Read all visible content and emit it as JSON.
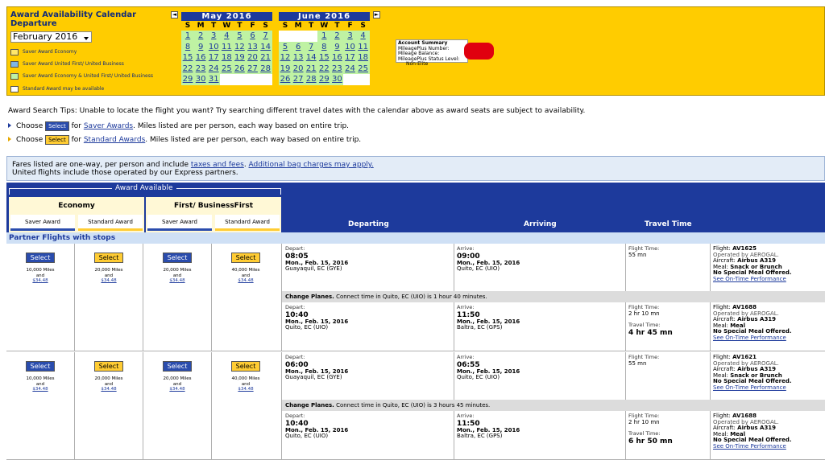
{
  "top": {
    "title_line1": "Award Availability Calendar",
    "title_line2": "Departure",
    "month_select": "February 2016",
    "legend": [
      {
        "label": "Saver Award Economy",
        "color": "#ffe76a"
      },
      {
        "label": "Saver Award United First/ United Business",
        "color": "#7fb6e6"
      },
      {
        "label": "Saver Award Economy & United First/ United Business",
        "color": "#bff2a3"
      },
      {
        "label": "Standard Award may be available",
        "color": "#ffffff"
      }
    ],
    "cal1": {
      "title": "May 2016",
      "days": [
        "S",
        "M",
        "T",
        "W",
        "T",
        "F",
        "S"
      ]
    },
    "cal2": {
      "title": "June 2016",
      "days": [
        "S",
        "M",
        "T",
        "W",
        "T",
        "F",
        "S"
      ]
    },
    "prev_icon": "◄",
    "next_icon": "►",
    "account": {
      "heading": "Account Summary",
      "l1": "MileagePlus Number:",
      "l2": "Mileage Balance:",
      "l3": "MileagePlus Status Level:",
      "status": "Non-Elite"
    }
  },
  "tips": {
    "line1": "Award Search Tips: Unable to locate the flight you want? Try searching different travel dates with the calendar above as award seats are subject to availability.",
    "choose": "Choose",
    "select": "Select",
    "for": "for",
    "saver_link": "Saver Awards",
    "standard_link": "Standard Awards",
    "rest": ". Miles listed are per person, each way based on entire trip."
  },
  "fares": {
    "a": "Fares listed are one-way, per person and include ",
    "taxes": "taxes and fees",
    "b": ". ",
    "bag": "Additional bag charges may apply.",
    "line2": "United flights include those operated by our Express partners."
  },
  "header": {
    "award_available": "Award Available",
    "economy": "Economy",
    "first": "First/ BusinessFirst",
    "saver": "Saver Award",
    "standard": "Standard Award",
    "departing": "Departing",
    "arriving": "Arriving",
    "travel_time": "Travel Time"
  },
  "partner": "Partner Flights with stops",
  "labels": {
    "depart": "Depart:",
    "arrive": "Arrive:",
    "flight_time": "Flight Time:",
    "travel_time": "Travel Time:",
    "flight": "Flight:",
    "aircraft": "Aircraft:",
    "meal": "Meal:",
    "no_special": "No Special Meal Offered.",
    "ontime": "See On-Time Performance",
    "change": "Change Planes.",
    "and": "and",
    "select": "Select"
  },
  "itineraries": [
    {
      "awards": [
        {
          "miles": "10,000 Miles",
          "tax": "$34.48"
        },
        {
          "miles": "20,000 Miles",
          "tax": "$34.48"
        },
        {
          "miles": "20,000 Miles",
          "tax": "$34.48"
        },
        {
          "miles": "40,000 Miles",
          "tax": "$34.48"
        }
      ],
      "seg1": {
        "dep_time": "08:05",
        "dep_date": "Mon., Feb. 15, 2016",
        "dep_city": "Guayaquil, EC (GYE)",
        "arr_time": "09:00",
        "arr_date": "Mon., Feb. 15, 2016",
        "arr_city": "Quito, EC (UIO)",
        "ft": "55 mn",
        "flight": "AV1625",
        "op": "Operated by AEROGAL.",
        "aircraft": "Airbus A319",
        "meal": "Snack or Brunch"
      },
      "change": "Connect time in Quito, EC (UIO) is 1 hour 40 minutes.",
      "seg2": {
        "dep_time": "10:40",
        "dep_date": "Mon., Feb. 15, 2016",
        "dep_city": "Quito, EC (UIO)",
        "arr_time": "11:50",
        "arr_date": "Mon., Feb. 15, 2016",
        "arr_city": "Baltra, EC (GPS)",
        "ft": "2 hr 10 mn",
        "tt": "4 hr 45 mn",
        "flight": "AV1688",
        "op": "Operated by AEROGAL.",
        "aircraft": "Airbus A319",
        "meal": "Meal"
      }
    },
    {
      "awards": [
        {
          "miles": "10,000 Miles",
          "tax": "$34.48"
        },
        {
          "miles": "20,000 Miles",
          "tax": "$34.48"
        },
        {
          "miles": "20,000 Miles",
          "tax": "$34.48"
        },
        {
          "miles": "40,000 Miles",
          "tax": "$34.48"
        }
      ],
      "seg1": {
        "dep_time": "06:00",
        "dep_date": "Mon., Feb. 15, 2016",
        "dep_city": "Guayaquil, EC (GYE)",
        "arr_time": "06:55",
        "arr_date": "Mon., Feb. 15, 2016",
        "arr_city": "Quito, EC (UIO)",
        "ft": "55 mn",
        "flight": "AV1621",
        "op": "Operated by AEROGAL.",
        "aircraft": "Airbus A319",
        "meal": "Snack or Brunch"
      },
      "change": "Connect time in Quito, EC (UIO) is 3 hours 45 minutes.",
      "seg2": {
        "dep_time": "10:40",
        "dep_date": "Mon., Feb. 15, 2016",
        "dep_city": "Quito, EC (UIO)",
        "arr_time": "11:50",
        "arr_date": "Mon., Feb. 15, 2016",
        "arr_city": "Baltra, EC (GPS)",
        "ft": "2 hr 10 mn",
        "tt": "6 hr 50 mn",
        "flight": "AV1688",
        "op": "Operated by AEROGAL.",
        "aircraft": "Airbus A319",
        "meal": "Meal"
      }
    }
  ]
}
